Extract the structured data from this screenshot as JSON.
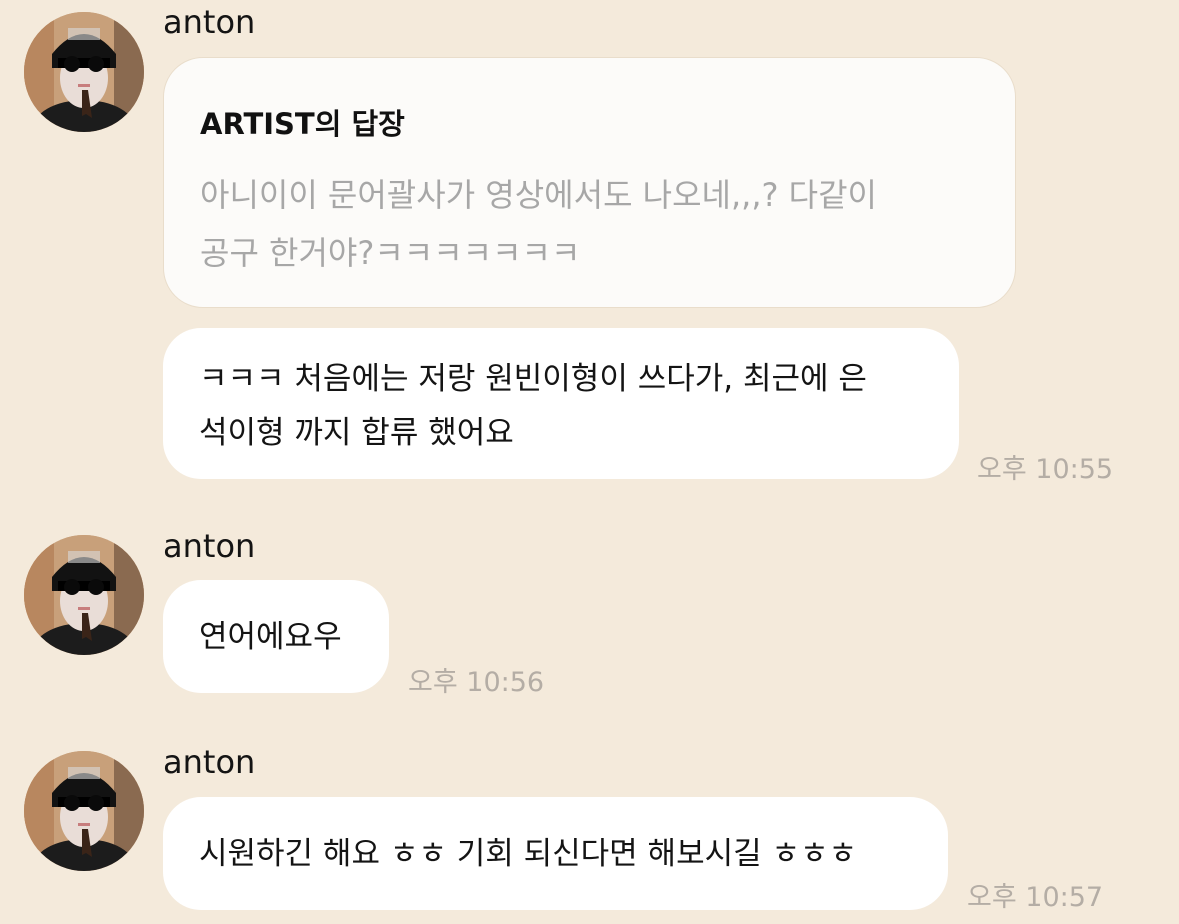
{
  "messages": [
    {
      "sender": "anton",
      "reply": {
        "title": "ARTIST의 답장",
        "line1": "아니이이 문어괄사가 영상에서도 나오네,,,? 다같이",
        "line2": "공구 한거야?ㅋㅋㅋㅋㅋㅋㅋ"
      },
      "text_line1": "ㅋㅋㅋ 처음에는 저랑 원빈이형이 쓰다가, 최근에 은",
      "text_line2": "석이형 까지 합류 했어요",
      "time": "오후 10:55"
    },
    {
      "sender": "anton",
      "text": "연어에요우",
      "time": "오후 10:56"
    },
    {
      "sender": "anton",
      "text": "시원하긴 해요 ㅎㅎ 기회 되신다면 해보시길 ㅎㅎㅎ",
      "time": "오후 10:57"
    }
  ],
  "colors": {
    "background": "#f4eadb",
    "bubble": "#ffffff",
    "reply_card": "#fcfbf9",
    "quoted_text": "#a7a7a7",
    "timestamp": "#b4ada5"
  },
  "icons": [
    "avatar-photo"
  ]
}
